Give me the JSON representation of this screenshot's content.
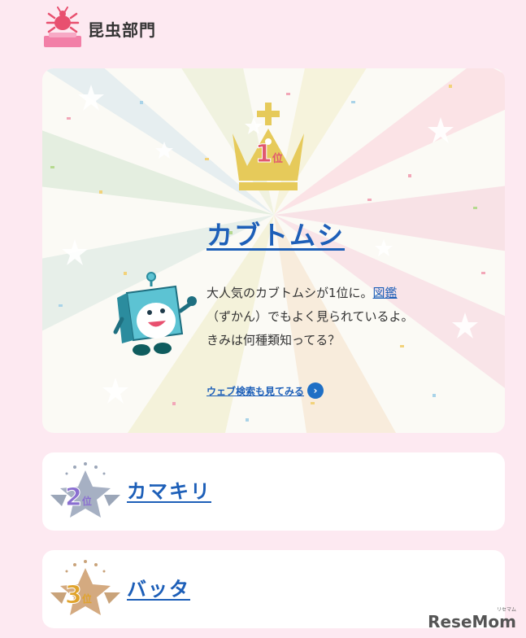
{
  "section": {
    "title": "昆虫部門",
    "icon": "beetle-trophy-icon"
  },
  "first": {
    "rank_number": "1",
    "rank_suffix": "位",
    "name": "カブトムシ",
    "desc_line1_prefix": "大人気のカブトムシが1位に。",
    "desc_link": "図鑑",
    "desc_line2": "（ずかん）でもよく見られているよ。",
    "desc_line3": "きみは何種類知ってる？",
    "web_search_label": "ウェブ検索も見てみる",
    "crown_color": "#e6ca5a",
    "rank_color": "#e0586f"
  },
  "second": {
    "rank_number": "2",
    "rank_suffix": "位",
    "name": "カマキリ",
    "color": "#8a6fd0"
  },
  "third": {
    "rank_number": "3",
    "rank_suffix": "位",
    "name": "バッタ",
    "color": "#e0a32b"
  },
  "watermark": {
    "text": "ReseMom",
    "small": "リセマム"
  },
  "colors": {
    "background": "#fde9f1",
    "link": "#1d5fb8",
    "accent_pink": "#f27fa7"
  }
}
